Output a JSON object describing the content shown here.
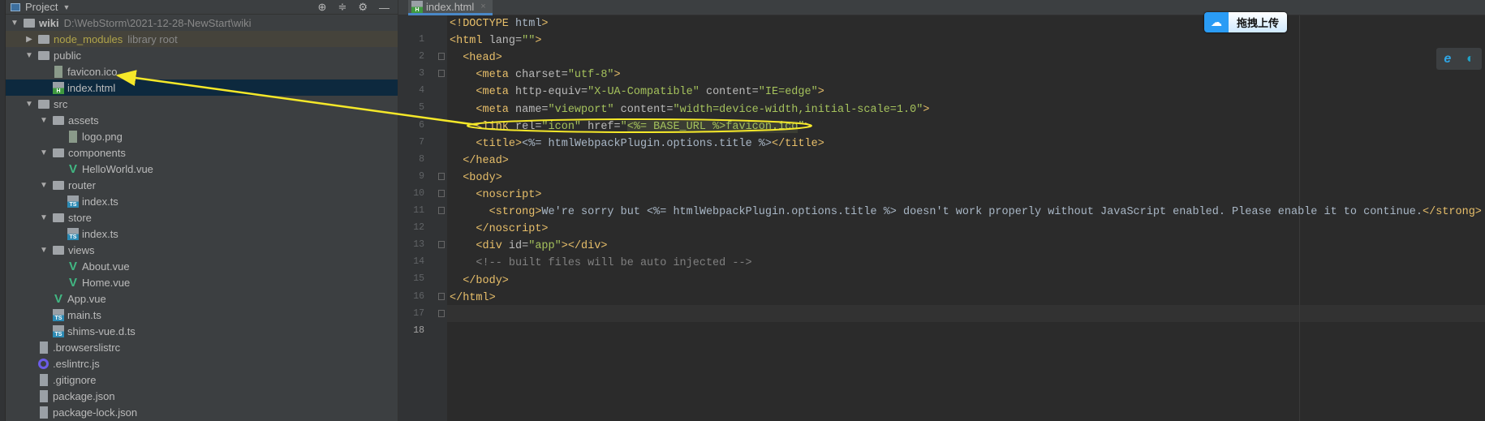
{
  "sidebar": {
    "title": "Project",
    "tree": [
      {
        "label": "wiki",
        "path": "D:\\WebStorm\\2021-12-28-NewStart\\wiki",
        "type": "folder",
        "depth": 0,
        "expanded": true,
        "bold": true
      },
      {
        "label": "node_modules",
        "path": "library root",
        "type": "folder",
        "depth": 1,
        "expanded": false,
        "lib": true
      },
      {
        "label": "public",
        "type": "folder",
        "depth": 1,
        "expanded": true
      },
      {
        "label": "favicon.ico",
        "type": "img",
        "depth": 2
      },
      {
        "label": "index.html",
        "type": "html",
        "depth": 2,
        "selected": true
      },
      {
        "label": "src",
        "type": "folder",
        "depth": 1,
        "expanded": true
      },
      {
        "label": "assets",
        "type": "folder",
        "depth": 2,
        "expanded": true
      },
      {
        "label": "logo.png",
        "type": "img",
        "depth": 3
      },
      {
        "label": "components",
        "type": "folder",
        "depth": 2,
        "expanded": true
      },
      {
        "label": "HelloWorld.vue",
        "type": "vue",
        "depth": 3
      },
      {
        "label": "router",
        "type": "folder",
        "depth": 2,
        "expanded": true
      },
      {
        "label": "index.ts",
        "type": "ts",
        "depth": 3
      },
      {
        "label": "store",
        "type": "folder",
        "depth": 2,
        "expanded": true
      },
      {
        "label": "index.ts",
        "type": "ts",
        "depth": 3
      },
      {
        "label": "views",
        "type": "folder",
        "depth": 2,
        "expanded": true
      },
      {
        "label": "About.vue",
        "type": "vue",
        "depth": 3
      },
      {
        "label": "Home.vue",
        "type": "vue",
        "depth": 3
      },
      {
        "label": "App.vue",
        "type": "vue",
        "depth": 2
      },
      {
        "label": "main.ts",
        "type": "ts",
        "depth": 2
      },
      {
        "label": "shims-vue.d.ts",
        "type": "ts",
        "depth": 2
      },
      {
        "label": ".browserslistrc",
        "type": "doc",
        "depth": 1
      },
      {
        "label": ".eslintrc.js",
        "type": "eslint",
        "depth": 1
      },
      {
        "label": ".gitignore",
        "type": "doc",
        "depth": 1
      },
      {
        "label": "package.json",
        "type": "doc",
        "depth": 1
      },
      {
        "label": "package-lock.json",
        "type": "doc",
        "depth": 1
      }
    ]
  },
  "editor": {
    "tab": {
      "label": "index.html",
      "close": "×"
    },
    "current_line": 18,
    "lines": [
      {
        "n": "1",
        "tokens": [
          [
            "tag",
            "<!DOCTYPE "
          ],
          [
            "txt",
            "html"
          ],
          [
            "tag",
            ">"
          ]
        ]
      },
      {
        "n": "2",
        "fold": true,
        "tokens": [
          [
            "tag",
            "<html "
          ],
          [
            "attr",
            "lang="
          ],
          [
            "str",
            "\"\""
          ],
          [
            "tag",
            ">"
          ]
        ]
      },
      {
        "n": "3",
        "fold": true,
        "tokens": [
          [
            "txt",
            "  "
          ],
          [
            "tag",
            "<head>"
          ]
        ]
      },
      {
        "n": "4",
        "tokens": [
          [
            "txt",
            "    "
          ],
          [
            "tag",
            "<meta "
          ],
          [
            "attr",
            "charset="
          ],
          [
            "str",
            "\"utf-8\""
          ],
          [
            "tag",
            ">"
          ]
        ]
      },
      {
        "n": "5",
        "tokens": [
          [
            "txt",
            "    "
          ],
          [
            "tag",
            "<meta "
          ],
          [
            "attr",
            "http-equiv="
          ],
          [
            "str",
            "\"X-UA-Compatible\""
          ],
          [
            "attr",
            " content="
          ],
          [
            "str",
            "\"IE=edge\""
          ],
          [
            "tag",
            ">"
          ]
        ]
      },
      {
        "n": "6",
        "tokens": [
          [
            "txt",
            "    "
          ],
          [
            "tag",
            "<meta "
          ],
          [
            "attr",
            "name="
          ],
          [
            "str",
            "\"viewport\""
          ],
          [
            "attr",
            " content="
          ],
          [
            "str",
            "\"width=device-width,initial-scale=1.0\""
          ],
          [
            "tag",
            ">"
          ]
        ]
      },
      {
        "n": "7",
        "tokens": [
          [
            "txt",
            "    "
          ],
          [
            "tag",
            "<link "
          ],
          [
            "attr",
            "rel="
          ],
          [
            "str",
            "\"icon\""
          ],
          [
            "attr",
            " href="
          ],
          [
            "str",
            "\""
          ],
          [
            "hl",
            "<%= BASE_URL %>favicon.ico"
          ],
          [
            "str",
            "\""
          ],
          [
            "tag",
            ">"
          ]
        ]
      },
      {
        "n": "8",
        "tokens": [
          [
            "txt",
            "    "
          ],
          [
            "tag",
            "<title>"
          ],
          [
            "txt",
            "<%= htmlWebpackPlugin.options.title %>"
          ],
          [
            "tag",
            "</title>"
          ]
        ]
      },
      {
        "n": "9",
        "fold": true,
        "tokens": [
          [
            "txt",
            "  "
          ],
          [
            "tag",
            "</head>"
          ]
        ]
      },
      {
        "n": "10",
        "fold": true,
        "tokens": [
          [
            "txt",
            "  "
          ],
          [
            "tag",
            "<body>"
          ]
        ]
      },
      {
        "n": "11",
        "fold": true,
        "tokens": [
          [
            "txt",
            "    "
          ],
          [
            "tag",
            "<noscript>"
          ]
        ]
      },
      {
        "n": "12",
        "tokens": [
          [
            "txt",
            "      "
          ],
          [
            "tag",
            "<strong>"
          ],
          [
            "txt",
            "We're sorry but <%= htmlWebpackPlugin.options.title %> doesn't work properly without JavaScript enabled. Please enable it to continue."
          ],
          [
            "tag",
            "</strong>"
          ]
        ]
      },
      {
        "n": "13",
        "fold": true,
        "tokens": [
          [
            "txt",
            "    "
          ],
          [
            "tag",
            "</noscript>"
          ]
        ]
      },
      {
        "n": "14",
        "tokens": [
          [
            "txt",
            "    "
          ],
          [
            "tag",
            "<div "
          ],
          [
            "attr",
            "id="
          ],
          [
            "str",
            "\"app\""
          ],
          [
            "tag",
            "></div>"
          ]
        ]
      },
      {
        "n": "15",
        "tokens": [
          [
            "com",
            "    <!-- built files will be auto injected -->"
          ]
        ]
      },
      {
        "n": "16",
        "fold": true,
        "tokens": [
          [
            "txt",
            "  "
          ],
          [
            "tag",
            "</body>"
          ]
        ]
      },
      {
        "n": "17",
        "fold": true,
        "tokens": [
          [
            "tag",
            "</html>"
          ]
        ]
      },
      {
        "n": "18",
        "tokens": []
      }
    ]
  },
  "overlays": {
    "baidu_upload": {
      "label": "拖拽上传",
      "icon": "baidu-netdisk-icon"
    },
    "browsers": [
      {
        "icon": "ie-icon"
      },
      {
        "icon": "edge-icon"
      }
    ],
    "annotation_color": "#f5e829"
  },
  "colors": {
    "tag": "#e8bf6a",
    "attr": "#bababa",
    "str": "#a5c25c",
    "txt": "#a9b7c6",
    "com": "#808080",
    "selected_row": "#0d293e"
  }
}
